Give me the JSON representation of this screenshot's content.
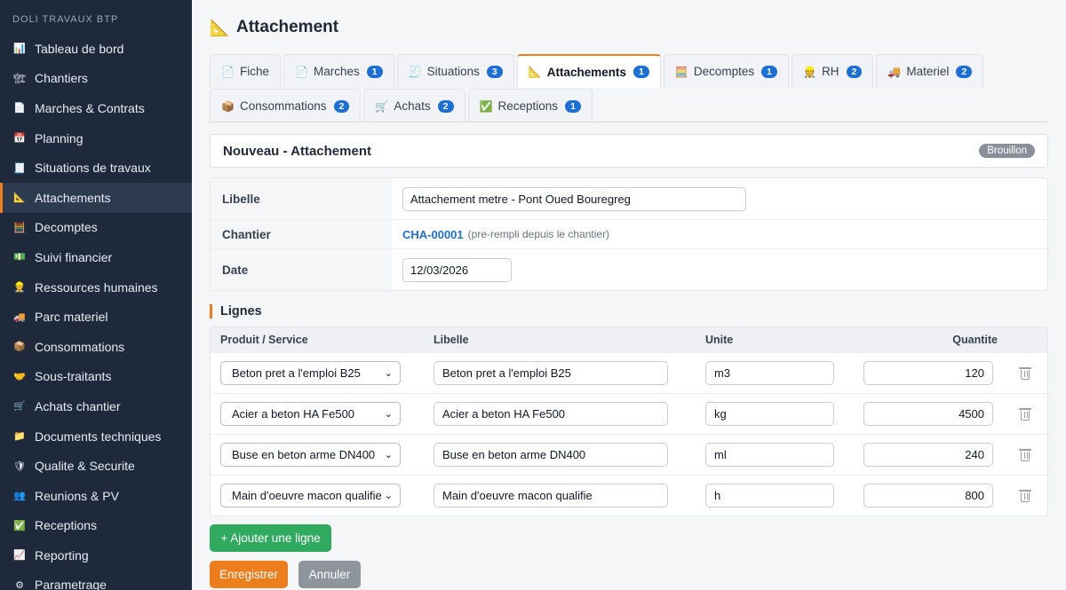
{
  "sidebar": {
    "brand": "DOLI TRAVAUX BTP",
    "items": [
      {
        "label": "Tableau de bord",
        "icon": "📊"
      },
      {
        "label": "Chantiers",
        "icon": "🏗"
      },
      {
        "label": "Marches & Contrats",
        "icon": "📄"
      },
      {
        "label": "Planning",
        "icon": "📅"
      },
      {
        "label": "Situations de travaux",
        "icon": "🧾"
      },
      {
        "label": "Attachements",
        "icon": "📐"
      },
      {
        "label": "Decomptes",
        "icon": "🧮"
      },
      {
        "label": "Suivi financier",
        "icon": "💵"
      },
      {
        "label": "Ressources humaines",
        "icon": "👷"
      },
      {
        "label": "Parc materiel",
        "icon": "🚚"
      },
      {
        "label": "Consommations",
        "icon": "📦"
      },
      {
        "label": "Sous-traitants",
        "icon": "🤝"
      },
      {
        "label": "Achats chantier",
        "icon": "🛒"
      },
      {
        "label": "Documents techniques",
        "icon": "📁"
      },
      {
        "label": "Qualite & Securite",
        "icon": "🛡"
      },
      {
        "label": "Reunions & PV",
        "icon": "👥"
      },
      {
        "label": "Receptions",
        "icon": "✅"
      },
      {
        "label": "Reporting",
        "icon": "📈"
      },
      {
        "label": "Parametrage",
        "icon": "⚙"
      }
    ]
  },
  "page": {
    "title": "Attachement",
    "title_icon": "📐"
  },
  "tabs": {
    "fiche": {
      "label": "Fiche",
      "icon": "📄"
    },
    "marches": {
      "label": "Marches",
      "icon": "📄",
      "badge": "1"
    },
    "situations": {
      "label": "Situations",
      "icon": "🧾",
      "badge": "3"
    },
    "attachements": {
      "label": "Attachements",
      "icon": "📐",
      "badge": "1"
    },
    "decomptes": {
      "label": "Decomptes",
      "icon": "🧮",
      "badge": "1"
    },
    "rh": {
      "label": "RH",
      "icon": "👷",
      "badge": "2"
    },
    "materiel": {
      "label": "Materiel",
      "icon": "🚚",
      "badge": "2"
    },
    "consommations": {
      "label": "Consommations",
      "icon": "📦",
      "badge": "2"
    },
    "achats": {
      "label": "Achats",
      "icon": "🛒",
      "badge": "2"
    },
    "receptions": {
      "label": "Receptions",
      "icon": "✅",
      "badge": "1"
    }
  },
  "card": {
    "title": "Nouveau - Attachement",
    "status": "Brouillon"
  },
  "form": {
    "libelle_label": "Libelle",
    "libelle_value": "Attachement metre - Pont Oued Bouregreg",
    "chantier_label": "Chantier",
    "chantier_ref": "CHA-00001",
    "chantier_hint": "(pre-rempli depuis le chantier)",
    "date_label": "Date",
    "date_value": "12/03/2026"
  },
  "lines": {
    "section_title": "Lignes",
    "headers": {
      "product": "Produit / Service",
      "libelle": "Libelle",
      "unit": "Unite",
      "qty": "Quantite"
    },
    "rows": [
      {
        "product": "Beton pret a l'emploi B25",
        "libelle": "Beton pret a l'emploi B25",
        "unit": "m3",
        "qty": "120"
      },
      {
        "product": "Acier a beton HA Fe500",
        "libelle": "Acier a beton HA Fe500",
        "unit": "kg",
        "qty": "4500"
      },
      {
        "product": "Buse en beton arme DN400",
        "libelle": "Buse en beton arme DN400",
        "unit": "ml",
        "qty": "240"
      },
      {
        "product": "Main d'oeuvre macon qualifie",
        "libelle": "Main d'oeuvre macon qualifie",
        "unit": "h",
        "qty": "800"
      }
    ]
  },
  "buttons": {
    "add_line": "+ Ajouter une ligne",
    "save": "Enregistrer",
    "cancel": "Annuler"
  },
  "colors": {
    "accent": "#f07f1a",
    "sidebar_bg": "#1e2a3b",
    "badge": "#1d6fd8",
    "add_button": "#2faa5e",
    "cancel_button": "#8f959d"
  }
}
